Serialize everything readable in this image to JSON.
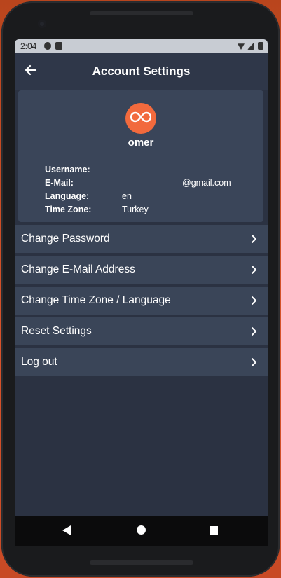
{
  "status": {
    "time": "2:04"
  },
  "appbar": {
    "title": "Account Settings"
  },
  "profile": {
    "name": "omer",
    "fields": [
      {
        "key": "Username:",
        "value": ""
      },
      {
        "key": "E-Mail:",
        "value": "@gmail.com"
      },
      {
        "key": "Language:",
        "value": "en"
      },
      {
        "key": "Time Zone:",
        "value": "Turkey"
      }
    ]
  },
  "menu": [
    {
      "label": "Change Password"
    },
    {
      "label": "Change E-Mail Address"
    },
    {
      "label": "Change Time Zone / Language"
    },
    {
      "label": "Reset Settings"
    },
    {
      "label": "Log out"
    }
  ],
  "colors": {
    "accent": "#f26a3d",
    "background": "#2b3242",
    "card": "#3a4559"
  }
}
